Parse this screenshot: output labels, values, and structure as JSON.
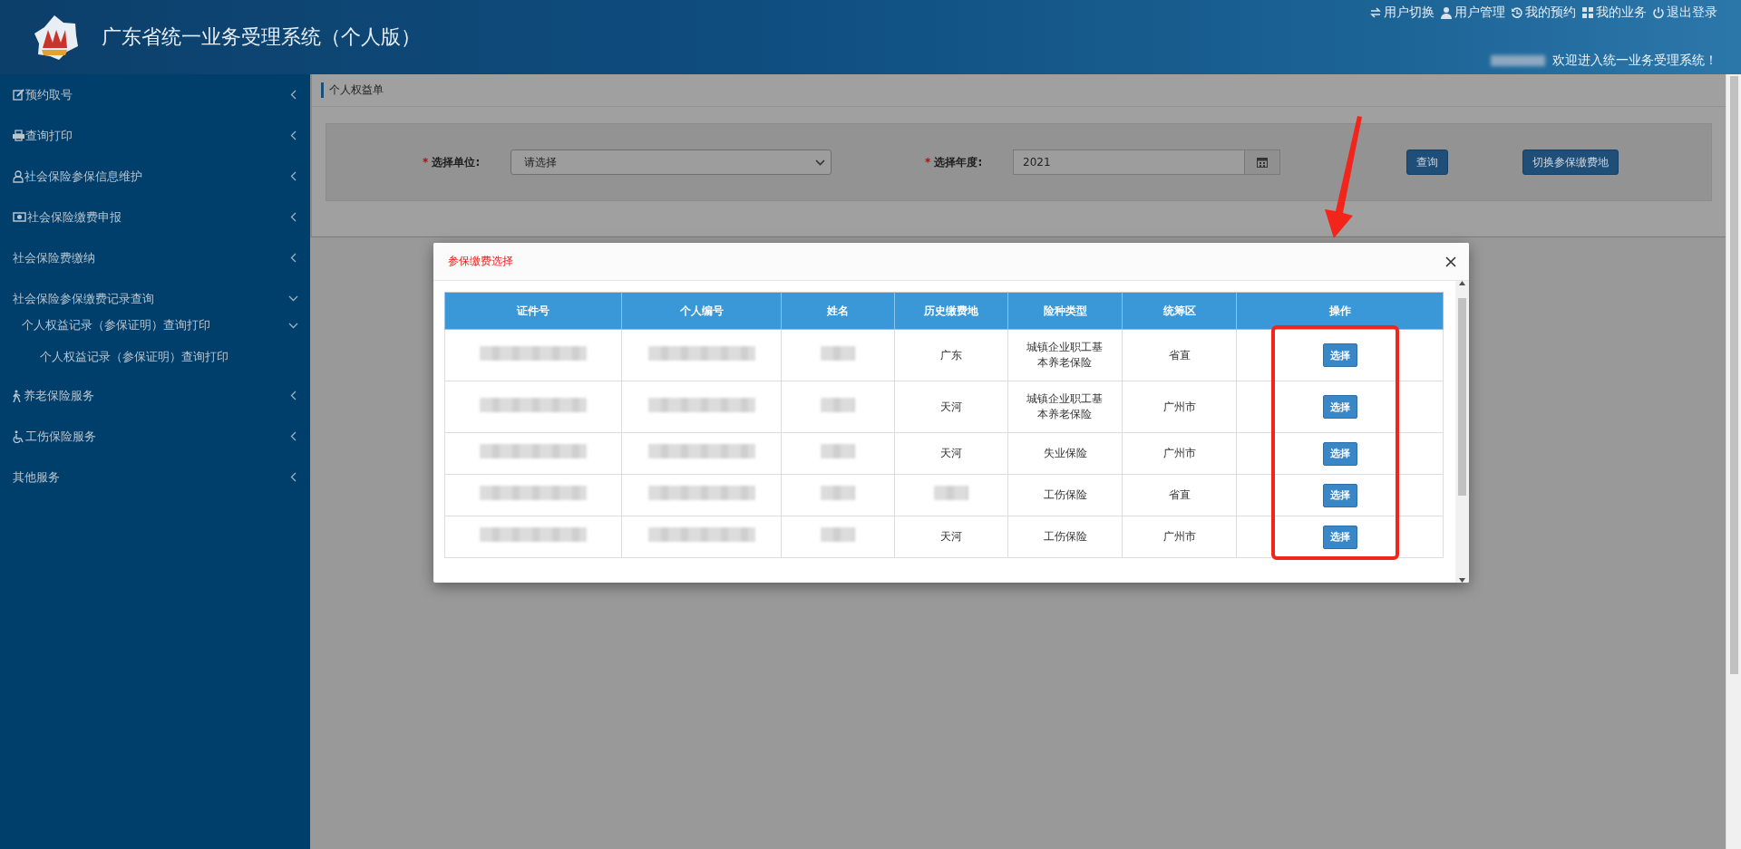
{
  "header": {
    "title": "广东省统一业务受理系统（个人版）",
    "links": [
      {
        "label": "用户切换"
      },
      {
        "label": "用户管理"
      },
      {
        "label": "我的预约"
      },
      {
        "label": "我的业务"
      },
      {
        "label": "退出登录"
      }
    ],
    "welcome": "欢迎进入统一业务受理系统！"
  },
  "sidebar": {
    "items": [
      {
        "label": "预约取号",
        "expanded": false
      },
      {
        "label": "查询打印",
        "expanded": false
      },
      {
        "label": "社会保险参保信息维护",
        "expanded": false
      },
      {
        "label": "社会保险缴费申报",
        "expanded": false
      },
      {
        "label": "社会保险费缴纳",
        "expanded": false
      },
      {
        "label": "社会保险参保缴费记录查询",
        "expanded": true,
        "children": [
          {
            "label": "个人权益记录（参保证明）查询打印",
            "expanded": true,
            "children": [
              {
                "label": "个人权益记录（参保证明）查询打印"
              }
            ]
          }
        ]
      },
      {
        "label": "养老保险服务",
        "expanded": false
      },
      {
        "label": "工伤保险服务",
        "expanded": false
      },
      {
        "label": "其他服务",
        "expanded": false
      }
    ]
  },
  "breadcrumb": "个人权益单",
  "form": {
    "fields": [
      {
        "kind": "select",
        "required_mark": "*",
        "label": "选择单位:",
        "value": "请选择"
      },
      {
        "kind": "date",
        "required_mark": "*",
        "label": "选择年度:",
        "value": "2021"
      }
    ],
    "buttons": [
      "查询",
      "切换参保缴费地"
    ]
  },
  "dialog": {
    "title": "参保缴费选择",
    "columns": [
      "证件号",
      "个人编号",
      "姓名",
      "历史缴费地",
      "险种类型",
      "统筹区",
      "操作"
    ],
    "rows": [
      {
        "cells": [
          {
            "kind": "blurred"
          },
          {
            "kind": "blurred"
          },
          {
            "kind": "blurred"
          },
          {
            "kind": "text",
            "text": "广东"
          },
          {
            "kind": "text",
            "text": "城镇企业职工基本养老保险"
          },
          {
            "kind": "text",
            "text": "省直"
          },
          {
            "kind": "button",
            "text": "选择"
          }
        ]
      },
      {
        "cells": [
          {
            "kind": "blurred"
          },
          {
            "kind": "blurred"
          },
          {
            "kind": "blurred"
          },
          {
            "kind": "text",
            "text": "天河"
          },
          {
            "kind": "text",
            "text": "城镇企业职工基本养老保险"
          },
          {
            "kind": "text",
            "text": "广州市"
          },
          {
            "kind": "button",
            "text": "选择"
          }
        ]
      },
      {
        "cells": [
          {
            "kind": "blurred"
          },
          {
            "kind": "blurred"
          },
          {
            "kind": "blurred"
          },
          {
            "kind": "text",
            "text": "天河"
          },
          {
            "kind": "text",
            "text": "失业保险"
          },
          {
            "kind": "text",
            "text": "广州市"
          },
          {
            "kind": "button",
            "text": "选择"
          }
        ]
      },
      {
        "cells": [
          {
            "kind": "blurred"
          },
          {
            "kind": "blurred"
          },
          {
            "kind": "blurred"
          },
          {
            "kind": "blurred"
          },
          {
            "kind": "text",
            "text": "工伤保险"
          },
          {
            "kind": "text",
            "text": "省直"
          },
          {
            "kind": "button",
            "text": "选择"
          }
        ]
      },
      {
        "cells": [
          {
            "kind": "blurred"
          },
          {
            "kind": "blurred"
          },
          {
            "kind": "blurred"
          },
          {
            "kind": "text",
            "text": "天河"
          },
          {
            "kind": "text",
            "text": "工伤保险"
          },
          {
            "kind": "text",
            "text": "广州市"
          },
          {
            "kind": "button",
            "text": "选择"
          }
        ]
      }
    ]
  }
}
